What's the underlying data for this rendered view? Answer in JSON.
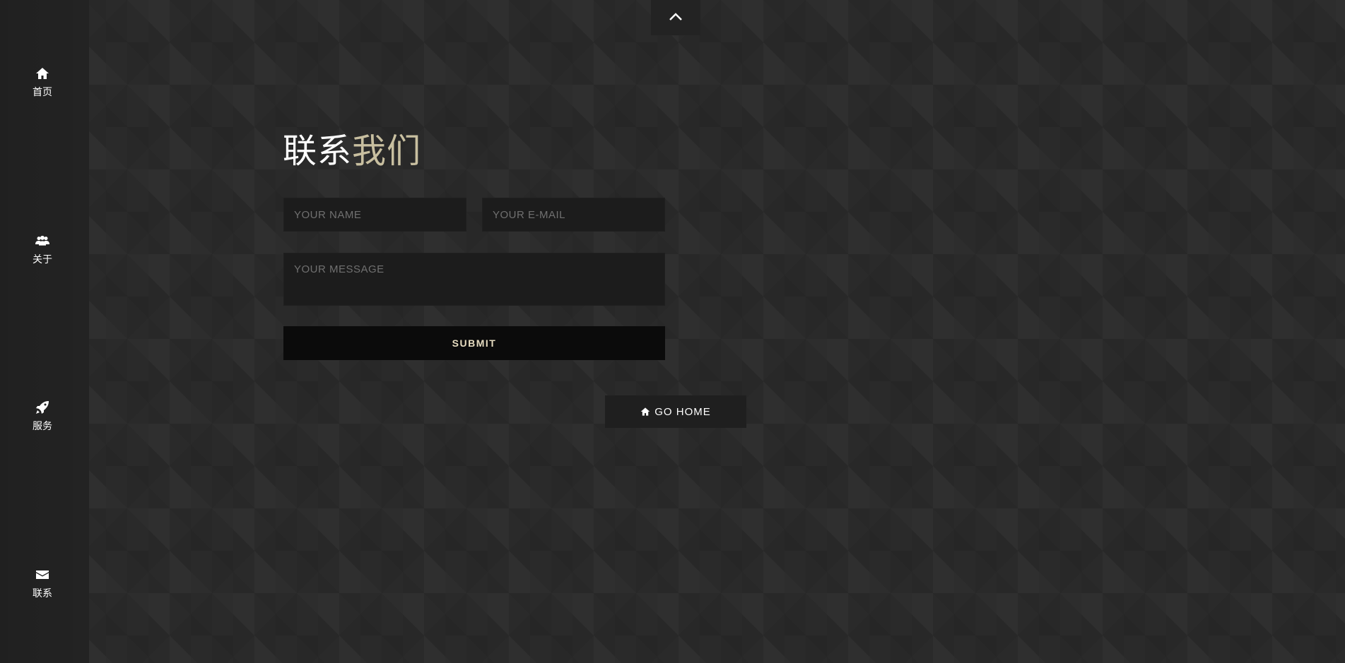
{
  "sidebar": {
    "items": [
      {
        "label": "首页",
        "icon": "home-icon"
      },
      {
        "label": "关于",
        "icon": "users-icon"
      },
      {
        "label": "服务",
        "icon": "rocket-icon"
      },
      {
        "label": "联系",
        "icon": "envelope-icon"
      }
    ]
  },
  "top_button": {
    "icon": "chevron-up-icon"
  },
  "contact": {
    "title_part1": "联系",
    "title_part2": "我们",
    "name_placeholder": "YOUR NAME",
    "email_placeholder": "YOUR E-MAIL",
    "message_placeholder": "YOUR MESSAGE",
    "submit_label": "SUBMIT"
  },
  "go_home": {
    "label": "GO HOME",
    "icon": "home-icon"
  },
  "colors": {
    "background": "#2a2a2a",
    "sidebar": "#232323",
    "accent": "#c8bfa0",
    "submit_bg": "#0b0b0b"
  }
}
